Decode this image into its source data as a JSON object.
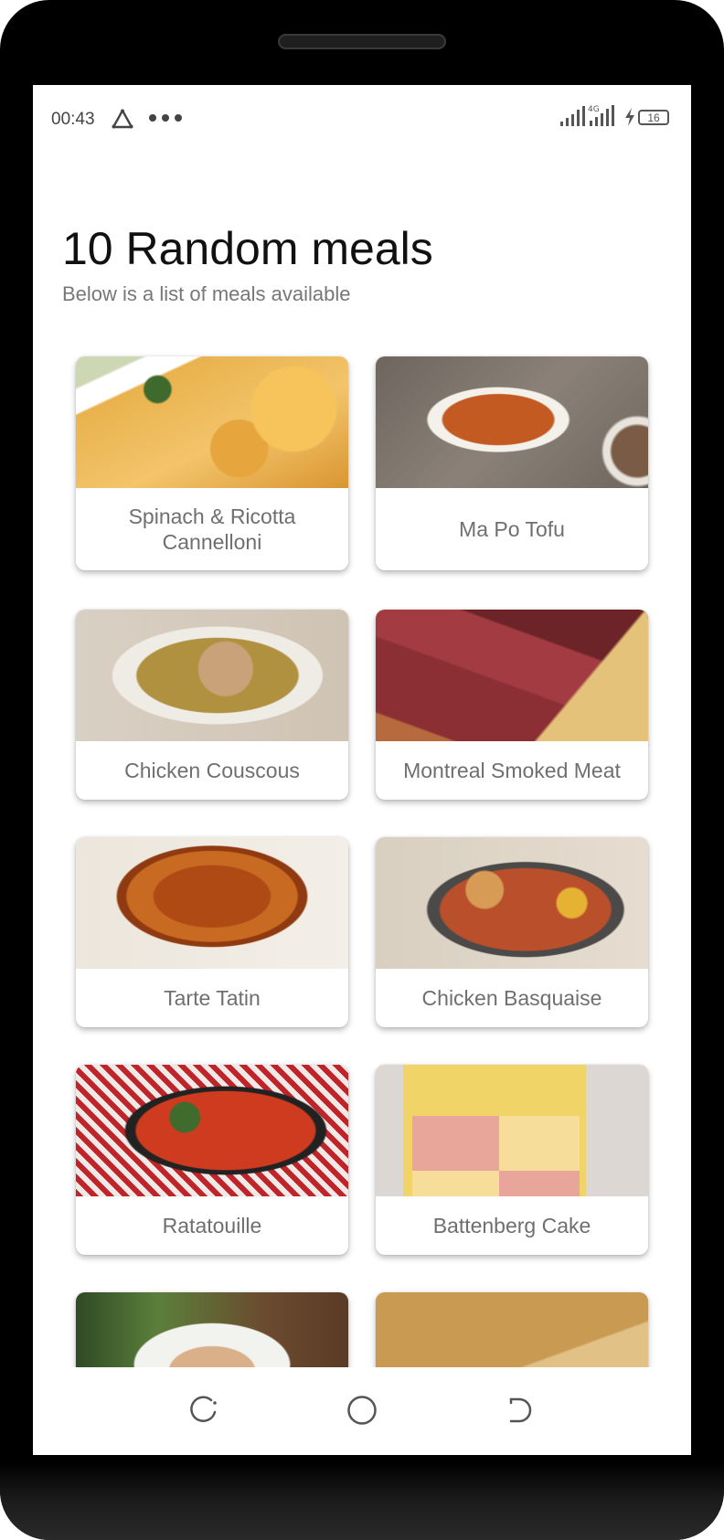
{
  "status_bar": {
    "time": "00:43",
    "battery_level": "16",
    "icons": [
      "triangle-alert-icon",
      "more-dots-icon",
      "signal-icon",
      "signal-icon",
      "charging-icon",
      "battery-icon"
    ]
  },
  "header": {
    "title": "10 Random meals",
    "subtitle": "Below is a list of meals available"
  },
  "meals": [
    {
      "name": "Spinach & Ricotta Cannelloni"
    },
    {
      "name": "Ma Po Tofu"
    },
    {
      "name": "Chicken Couscous"
    },
    {
      "name": "Montreal Smoked Meat"
    },
    {
      "name": "Tarte Tatin"
    },
    {
      "name": "Chicken Basquaise"
    },
    {
      "name": "Ratatouille"
    },
    {
      "name": "Battenberg Cake"
    },
    {
      "name": ""
    },
    {
      "name": ""
    }
  ],
  "nav_bar": {
    "icons": [
      "recent-apps-icon",
      "home-icon",
      "back-icon"
    ]
  }
}
